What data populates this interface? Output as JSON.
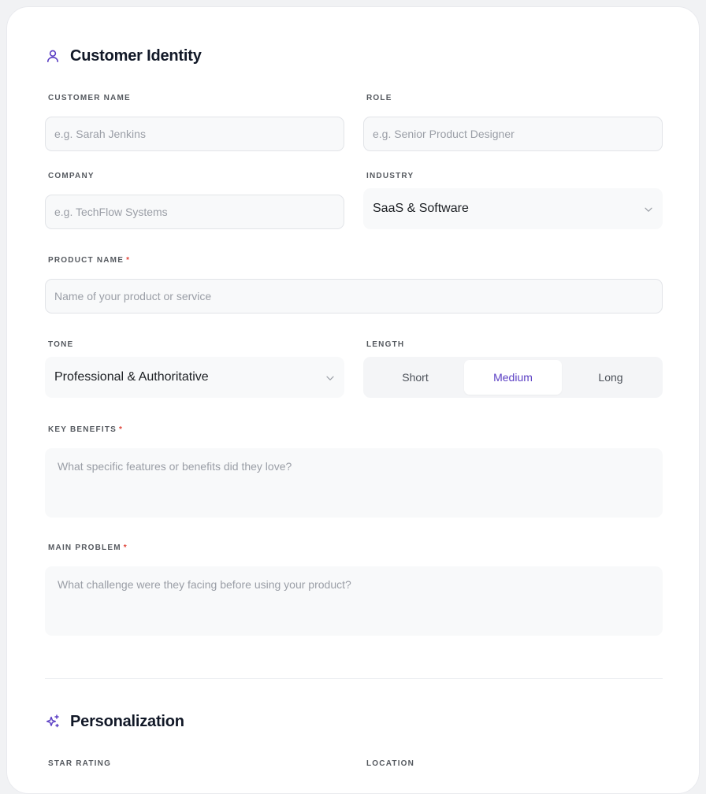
{
  "identity": {
    "title": "Customer Identity",
    "icon": "user-icon"
  },
  "fields": {
    "customer_name": {
      "label": "CUSTOMER NAME",
      "placeholder": "e.g. Sarah Jenkins",
      "value": ""
    },
    "role": {
      "label": "ROLE",
      "placeholder": "e.g. Senior Product Designer",
      "value": ""
    },
    "company": {
      "label": "COMPANY",
      "placeholder": "e.g. TechFlow Systems",
      "value": ""
    },
    "industry": {
      "label": "INDUSTRY",
      "value": "SaaS & Software"
    },
    "product_name": {
      "label": "PRODUCT NAME",
      "required": "*",
      "placeholder": "Name of your product or service",
      "value": ""
    },
    "tone": {
      "label": "TONE",
      "value": "Professional & Authoritative"
    },
    "length": {
      "label": "LENGTH",
      "options": [
        "Short",
        "Medium",
        "Long"
      ],
      "selected": "Medium"
    },
    "key_benefits": {
      "label": "KEY BENEFITS",
      "required": "*",
      "placeholder": "What specific features or benefits did they love?",
      "value": ""
    },
    "main_problem": {
      "label": "MAIN PROBLEM",
      "required": "*",
      "placeholder": "What challenge were they facing before using your product?",
      "value": ""
    }
  },
  "personalization": {
    "title": "Personalization",
    "icon": "sparkles-icon",
    "star_rating_label": "STAR RATING",
    "location_label": "LOCATION"
  },
  "colors": {
    "accent": "#5b3fc4",
    "required": "#e0453a"
  }
}
